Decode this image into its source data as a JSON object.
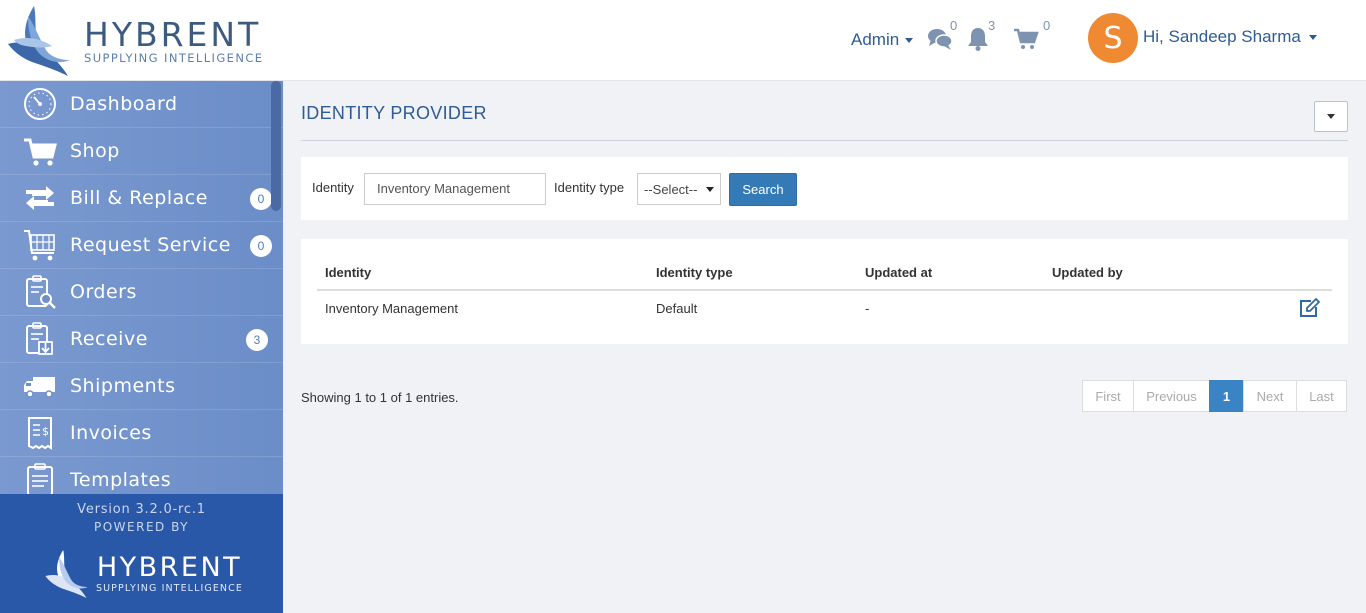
{
  "brand": {
    "name": "HYBRENT",
    "tagline": "SUPPLYING INTELLIGENCE"
  },
  "header": {
    "admin_label": "Admin",
    "messages_count": "0",
    "notifications_count": "3",
    "cart_count": "0",
    "avatar_initial": "S",
    "greeting": "Hi, Sandeep Sharma"
  },
  "sidebar": {
    "items": [
      {
        "label": "Dashboard",
        "icon": "dashboard-icon"
      },
      {
        "label": "Shop",
        "icon": "cart-icon"
      },
      {
        "label": "Bill & Replace",
        "icon": "bill-replace-icon",
        "badge": "0"
      },
      {
        "label": "Request Service",
        "icon": "request-service-icon",
        "badge": "0"
      },
      {
        "label": "Orders",
        "icon": "orders-icon"
      },
      {
        "label": "Receive",
        "icon": "receive-icon",
        "badge": "3"
      },
      {
        "label": "Shipments",
        "icon": "truck-icon"
      },
      {
        "label": "Invoices",
        "icon": "invoice-icon"
      },
      {
        "label": "Templates",
        "icon": "templates-icon"
      }
    ],
    "version": "Version 3.2.0-rc.1",
    "powered_by": "POWERED BY"
  },
  "page": {
    "title": "IDENTITY PROVIDER"
  },
  "filters": {
    "identity_label": "Identity",
    "identity_value": "Inventory Management",
    "identity_type_label": "Identity type",
    "identity_type_value": "--Select--",
    "search_button": "Search"
  },
  "table": {
    "columns": [
      "Identity",
      "Identity type",
      "Updated at",
      "Updated by"
    ],
    "rows": [
      {
        "identity": "Inventory Management",
        "identity_type": "Default",
        "updated_at": "-",
        "updated_by": ""
      }
    ]
  },
  "pagination": {
    "summary": "Showing 1 to 1 of 1 entries.",
    "first": "First",
    "previous": "Previous",
    "current": "1",
    "next": "Next",
    "last": "Last"
  },
  "colors": {
    "accent": "#337ab7",
    "sidebar": "#6e8fc9",
    "sidebar_footer": "#2a58a8",
    "avatar": "#f08a32",
    "brand_text": "#2d5c96"
  }
}
